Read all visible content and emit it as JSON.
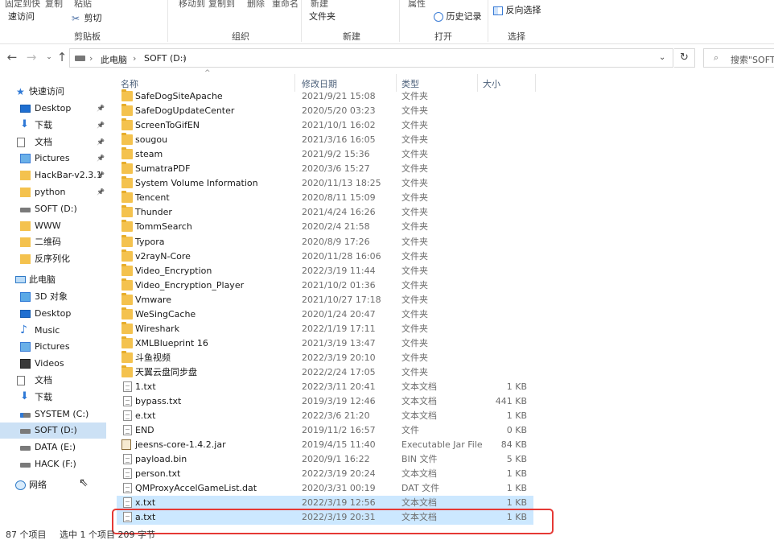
{
  "ribbon": {
    "top_labels": {
      "pin": "固定到快",
      "copy": "复制",
      "paste": "粘贴",
      "move_to": "移动到",
      "copy_to": "复制到",
      "delete": "删除",
      "rename": "重命名",
      "new": "新建",
      "properties": "属性"
    },
    "quick_access": "速访问",
    "cut": "剪切",
    "new_folder": "文件夹",
    "history": "历史记录",
    "invert_selection": "反向选择",
    "groups": {
      "clipboard": "剪贴板",
      "organize": "组织",
      "new": "新建",
      "open": "打开",
      "select": "选择"
    }
  },
  "address": {
    "breadcrumb": [
      "此电脑",
      "SOFT (D:)"
    ],
    "search_placeholder": "搜索\"SOFT"
  },
  "nav": {
    "quick_access": "快速访问",
    "pinned": [
      {
        "label": "Desktop",
        "icon": "desktop-icon",
        "pinned": true
      },
      {
        "label": "下载",
        "icon": "download-icon",
        "pinned": true
      },
      {
        "label": "文档",
        "icon": "document-icon",
        "pinned": true
      },
      {
        "label": "Pictures",
        "icon": "pictures-icon",
        "pinned": true
      },
      {
        "label": "HackBar-v2.3.1",
        "icon": "folder-icon",
        "pinned": true
      },
      {
        "label": "python",
        "icon": "folder-icon",
        "pinned": true
      },
      {
        "label": "SOFT (D:)",
        "icon": "drive-icon",
        "pinned": false
      },
      {
        "label": "WWW",
        "icon": "folder-icon",
        "pinned": false
      },
      {
        "label": "二维码",
        "icon": "folder-icon",
        "pinned": false
      },
      {
        "label": "反序列化",
        "icon": "folder-icon",
        "pinned": false
      }
    ],
    "this_pc": "此电脑",
    "pc_items": [
      {
        "label": "3D 对象",
        "icon": "3d-objects-icon"
      },
      {
        "label": "Desktop",
        "icon": "desktop-icon"
      },
      {
        "label": "Music",
        "icon": "music-icon"
      },
      {
        "label": "Pictures",
        "icon": "pictures-icon"
      },
      {
        "label": "Videos",
        "icon": "videos-icon"
      },
      {
        "label": "文档",
        "icon": "document-icon"
      },
      {
        "label": "下载",
        "icon": "download-icon"
      },
      {
        "label": "SYSTEM (C:)",
        "icon": "system-drive-icon"
      },
      {
        "label": "SOFT (D:)",
        "icon": "drive-icon"
      },
      {
        "label": "DATA (E:)",
        "icon": "drive-icon"
      },
      {
        "label": "HACK (F:)",
        "icon": "drive-icon"
      }
    ],
    "network": "网络"
  },
  "columns": {
    "name": "名称",
    "date": "修改日期",
    "type": "类型",
    "size": "大小"
  },
  "files": [
    {
      "name": "SafeDogSiteApache",
      "date": "2021/9/21 15:08",
      "type": "文件夹",
      "size": "",
      "icon": "folder-icon"
    },
    {
      "name": "SafeDogUpdateCenter",
      "date": "2020/5/20 03:23",
      "type": "文件夹",
      "size": "",
      "icon": "folder-icon"
    },
    {
      "name": "ScreenToGifEN",
      "date": "2021/10/1 16:02",
      "type": "文件夹",
      "size": "",
      "icon": "folder-icon"
    },
    {
      "name": "sougou",
      "date": "2021/3/16 16:05",
      "type": "文件夹",
      "size": "",
      "icon": "folder-icon"
    },
    {
      "name": "steam",
      "date": "2021/9/2 15:36",
      "type": "文件夹",
      "size": "",
      "icon": "folder-icon"
    },
    {
      "name": "SumatraPDF",
      "date": "2020/3/6 15:27",
      "type": "文件夹",
      "size": "",
      "icon": "folder-icon"
    },
    {
      "name": "System Volume Information",
      "date": "2020/11/13 18:25",
      "type": "文件夹",
      "size": "",
      "icon": "folder-icon"
    },
    {
      "name": "Tencent",
      "date": "2020/8/11 15:09",
      "type": "文件夹",
      "size": "",
      "icon": "folder-icon"
    },
    {
      "name": "Thunder",
      "date": "2021/4/24 16:26",
      "type": "文件夹",
      "size": "",
      "icon": "folder-icon"
    },
    {
      "name": "TommSearch",
      "date": "2020/2/4 21:58",
      "type": "文件夹",
      "size": "",
      "icon": "folder-icon"
    },
    {
      "name": "Typora",
      "date": "2020/8/9 17:26",
      "type": "文件夹",
      "size": "",
      "icon": "folder-icon"
    },
    {
      "name": "v2rayN-Core",
      "date": "2020/11/28 16:06",
      "type": "文件夹",
      "size": "",
      "icon": "folder-icon"
    },
    {
      "name": "Video_Encryption",
      "date": "2022/3/19 11:44",
      "type": "文件夹",
      "size": "",
      "icon": "folder-icon"
    },
    {
      "name": "Video_Encryption_Player",
      "date": "2021/10/2 01:36",
      "type": "文件夹",
      "size": "",
      "icon": "folder-icon"
    },
    {
      "name": "Vmware",
      "date": "2021/10/27 17:18",
      "type": "文件夹",
      "size": "",
      "icon": "folder-icon"
    },
    {
      "name": "WeSingCache",
      "date": "2020/1/24 20:47",
      "type": "文件夹",
      "size": "",
      "icon": "folder-icon"
    },
    {
      "name": "Wireshark",
      "date": "2022/1/19 17:11",
      "type": "文件夹",
      "size": "",
      "icon": "folder-icon"
    },
    {
      "name": "XMLBlueprint 16",
      "date": "2021/3/19 13:47",
      "type": "文件夹",
      "size": "",
      "icon": "folder-icon"
    },
    {
      "name": "斗鱼视频",
      "date": "2022/3/19 20:10",
      "type": "文件夹",
      "size": "",
      "icon": "folder-icon"
    },
    {
      "name": "天翼云盘同步盘",
      "date": "2022/2/24 17:05",
      "type": "文件夹",
      "size": "",
      "icon": "folder-icon"
    },
    {
      "name": "1.txt",
      "date": "2022/3/11 20:41",
      "type": "文本文档",
      "size": "1 KB",
      "icon": "text-file-icon"
    },
    {
      "name": "bypass.txt",
      "date": "2019/3/19 12:46",
      "type": "文本文档",
      "size": "441 KB",
      "icon": "text-file-icon"
    },
    {
      "name": "e.txt",
      "date": "2022/3/6 21:20",
      "type": "文本文档",
      "size": "1 KB",
      "icon": "text-file-icon"
    },
    {
      "name": "END",
      "date": "2019/11/2 16:57",
      "type": "文件",
      "size": "0 KB",
      "icon": "file-icon"
    },
    {
      "name": "jeesns-core-1.4.2.jar",
      "date": "2019/4/15 11:40",
      "type": "Executable Jar File",
      "size": "84 KB",
      "icon": "jar-file-icon"
    },
    {
      "name": "payload.bin",
      "date": "2020/9/1 16:22",
      "type": "BIN 文件",
      "size": "5 KB",
      "icon": "file-icon"
    },
    {
      "name": "person.txt",
      "date": "2022/3/19 20:24",
      "type": "文本文档",
      "size": "1 KB",
      "icon": "text-file-icon"
    },
    {
      "name": "QMProxyAccelGameList.dat",
      "date": "2020/3/31 00:19",
      "type": "DAT 文件",
      "size": "1 KB",
      "icon": "file-icon"
    },
    {
      "name": "x.txt",
      "date": "2022/3/19 12:56",
      "type": "文本文档",
      "size": "1 KB",
      "icon": "text-file-icon",
      "selected": true
    },
    {
      "name": "a.txt",
      "date": "2022/3/19 20:31",
      "type": "文本文档",
      "size": "1 KB",
      "icon": "text-file-icon",
      "selected": true
    }
  ],
  "status": {
    "count": "87 个项目",
    "selection": "选中 1 个项目 209 字节"
  },
  "colors": {
    "selection": "#cce8ff",
    "nav_selection": "#cce1f5",
    "highlight_box": "#e53935",
    "folder": "#f4c24e"
  }
}
